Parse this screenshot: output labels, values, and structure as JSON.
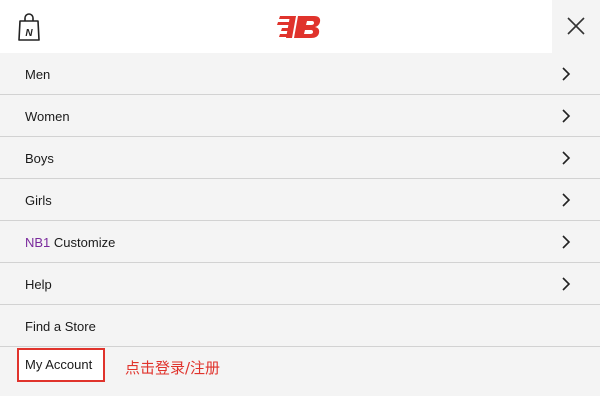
{
  "header": {
    "bag_icon_letter": "N",
    "brand_logo": "NB",
    "close_icon": "close-icon"
  },
  "menu": {
    "items": [
      {
        "label": "Men",
        "has_chevron": true
      },
      {
        "label": "Women",
        "has_chevron": true
      },
      {
        "label": "Boys",
        "has_chevron": true
      },
      {
        "label": "Girls",
        "has_chevron": true
      },
      {
        "prefix": "NB1",
        "label": " Customize",
        "has_chevron": true
      },
      {
        "label": "Help",
        "has_chevron": true
      },
      {
        "label": "Find a Store",
        "has_chevron": false
      }
    ],
    "account_label": "My Account"
  },
  "annotation": {
    "text": "点击登录/注册"
  },
  "colors": {
    "brand_red": "#e0332c",
    "nb1_purple": "#7a2a9c",
    "menu_bg": "#f4f4f4",
    "divider": "#d2d2d2"
  }
}
